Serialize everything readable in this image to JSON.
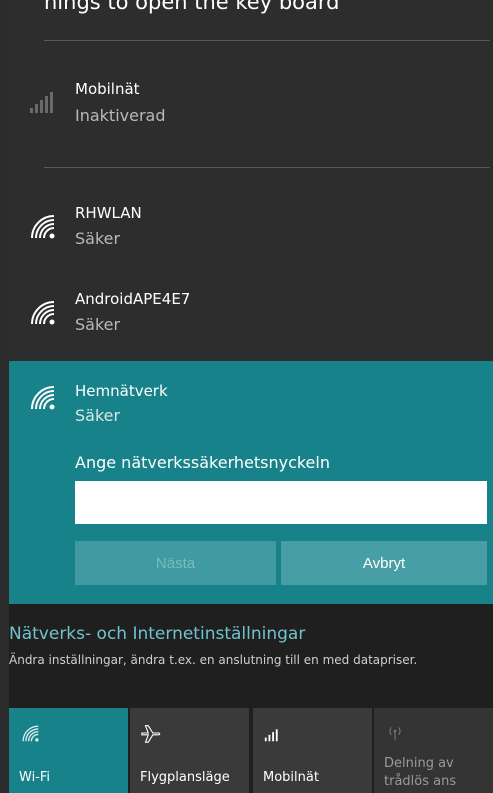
{
  "header": {
    "cutoff_text": "nings to open the key board"
  },
  "networks": [
    {
      "name": "Mobilnät",
      "status": "Inaktiverad",
      "icon": "cellular-signal-icon"
    },
    {
      "name": "RHWLAN",
      "status": "Säker",
      "icon": "wifi-icon"
    },
    {
      "name": "AndroidAPE4E7",
      "status": "Säker",
      "icon": "wifi-icon"
    },
    {
      "name": "Hemnätverk",
      "status": "Säker",
      "icon": "wifi-icon"
    }
  ],
  "connect_form": {
    "key_label": "Ange nätverkssäkerhetsnyckeln",
    "key_value": "",
    "next_label": "Nästa",
    "cancel_label": "Avbryt"
  },
  "settings": {
    "title": "Nätverks- och Internetinställningar",
    "subtitle": "Ändra inställningar, ändra t.ex. en anslutning till en med datapriser."
  },
  "quick_actions": [
    {
      "label": "Wi-Fi",
      "icon": "wifi-icon",
      "active": true
    },
    {
      "label": "Flygplansläge",
      "icon": "airplane-icon",
      "active": false
    },
    {
      "label": "Mobilnät",
      "icon": "cellular-signal-icon",
      "active": false
    },
    {
      "label": "Delning av trådlös ans",
      "icon": "hotspot-icon",
      "active": false,
      "disabled": true
    }
  ],
  "colors": {
    "accent": "#17828a",
    "panel_bg": "#2d2d2d",
    "tile_active": "#17828a",
    "tile_inactive": "#3a3a3a",
    "link": "#72c2cd"
  }
}
